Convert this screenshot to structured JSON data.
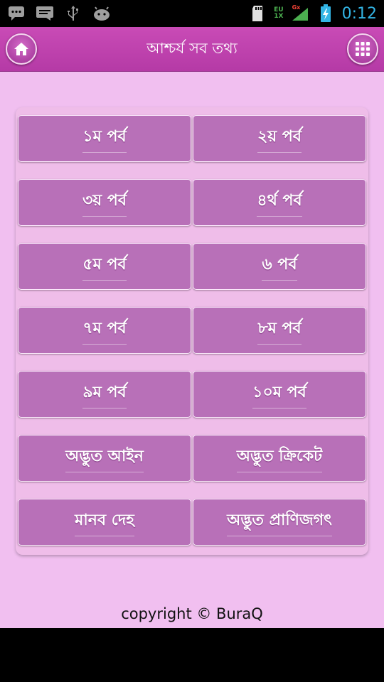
{
  "status_bar": {
    "icons": [
      "message-icon",
      "chat-icon",
      "usb-icon",
      "android-debug-icon",
      "sd-card-icon",
      "network-icon",
      "signal-icon",
      "battery-icon"
    ],
    "network_top": "EU",
    "network_bottom": "1X",
    "signal_label": "Gx",
    "time": "0:12",
    "time_color": "#33b5e5"
  },
  "action_bar": {
    "title": "আশ্চর্য সব তথ্য",
    "home_icon": "home-icon",
    "menu_icon": "grid-menu-icon",
    "color": "#c03fb0"
  },
  "parts": [
    {
      "label": "১ম পর্ব"
    },
    {
      "label": "২য় পর্ব"
    },
    {
      "label": "৩য় পর্ব"
    },
    {
      "label": "৪র্থ পর্ব"
    },
    {
      "label": "৫ম পর্ব"
    },
    {
      "label": "৬ পর্ব"
    },
    {
      "label": "৭ম পর্ব"
    },
    {
      "label": "৮ম পর্ব"
    },
    {
      "label": "৯ম পর্ব"
    },
    {
      "label": "১০ম পর্ব"
    },
    {
      "label": "অদ্ভুত আইন"
    },
    {
      "label": "অদ্ভুত ক্রিকেট"
    },
    {
      "label": "মানব দেহ"
    },
    {
      "label": "অদ্ভুত প্রাণিজগৎ"
    }
  ],
  "footer": {
    "copyright": "copyright © BuraQ"
  }
}
